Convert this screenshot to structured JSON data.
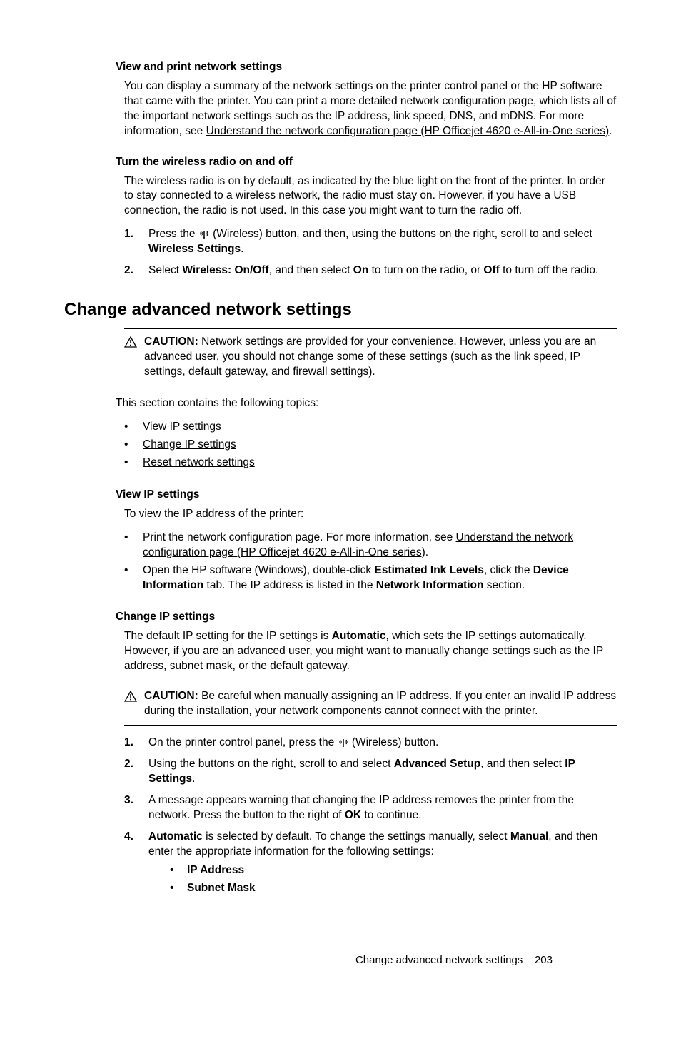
{
  "section_view_print": {
    "heading": "View and print network settings",
    "p1_a": "You can display a summary of the network settings on the printer control panel or the HP software that came with the printer. You can print a more detailed network configuration page, which lists all of the important network settings such as the IP address, link speed, DNS, and mDNS. For more information, see ",
    "p1_link": "Understand the network configuration page (HP Officejet 4620 e-All-in-One series)",
    "p1_b": "."
  },
  "section_radio": {
    "heading": "Turn the wireless radio on and off",
    "p1": "The wireless radio is on by default, as indicated by the blue light on the front of the printer. In order to stay connected to a wireless network, the radio must stay on. However, if you have a USB connection, the radio is not used. In this case you might want to turn the radio off.",
    "step1_a": "Press the ",
    "step1_b": " (Wireless) button, and then, using the buttons on the right, scroll to and select ",
    "step1_bold": "Wireless Settings",
    "step1_c": ".",
    "step2_a": "Select ",
    "step2_b1": "Wireless: On/Off",
    "step2_c": ", and then select ",
    "step2_b2": "On",
    "step2_d": " to turn on the radio, or ",
    "step2_b3": "Off",
    "step2_e": " to turn off the radio."
  },
  "section_advanced": {
    "heading": "Change advanced network settings",
    "caution_label": "CAUTION:",
    "caution_text": " Network settings are provided for your convenience. However, unless you are an advanced user, you should not change some of these settings (such as the link speed, IP settings, default gateway, and firewall settings).",
    "topics_intro": "This section contains the following topics:",
    "topics": [
      "View IP settings",
      "Change IP settings",
      "Reset network settings"
    ]
  },
  "section_view_ip": {
    "heading": "View IP settings",
    "p1": "To view the IP address of the printer:",
    "b1_a": "Print the network configuration page. For more information, see ",
    "b1_link": "Understand the network configuration page (HP Officejet 4620 e-All-in-One series)",
    "b1_b": ".",
    "b2_a": "Open the HP software (Windows), double-click ",
    "b2_bold1": "Estimated Ink Levels",
    "b2_b": ", click the ",
    "b2_bold2": "Device Information",
    "b2_c": " tab. The IP address is listed in the ",
    "b2_bold3": "Network Information",
    "b2_d": " section."
  },
  "section_change_ip": {
    "heading": "Change IP settings",
    "p1_a": "The default IP setting for the IP settings is ",
    "p1_bold": "Automatic",
    "p1_b": ", which sets the IP settings automatically. However, if you are an advanced user, you might want to manually change settings such as the IP address, subnet mask, or the default gateway.",
    "caution_label": "CAUTION:",
    "caution_text": " Be careful when manually assigning an IP address. If you enter an invalid IP address during the installation, your network components cannot connect with the printer.",
    "s1_a": "On the printer control panel, press the ",
    "s1_b": " (Wireless) button.",
    "s2_a": "Using the buttons on the right, scroll to and select ",
    "s2_b1": "Advanced Setup",
    "s2_b": ", and then select ",
    "s2_b2": "IP Settings",
    "s2_c": ".",
    "s3_a": "A message appears warning that changing the IP address removes the printer from the network. Press the button to the right of ",
    "s3_bold": "OK",
    "s3_b": " to continue.",
    "s4_b1": "Automatic",
    "s4_a": " is selected by default. To change the settings manually, select ",
    "s4_b2": "Manual",
    "s4_b": ", and then enter the appropriate information for the following settings:",
    "s4_sub": [
      "IP Address",
      "Subnet Mask"
    ]
  },
  "footer": {
    "text": "Change advanced network settings",
    "page": "203"
  }
}
